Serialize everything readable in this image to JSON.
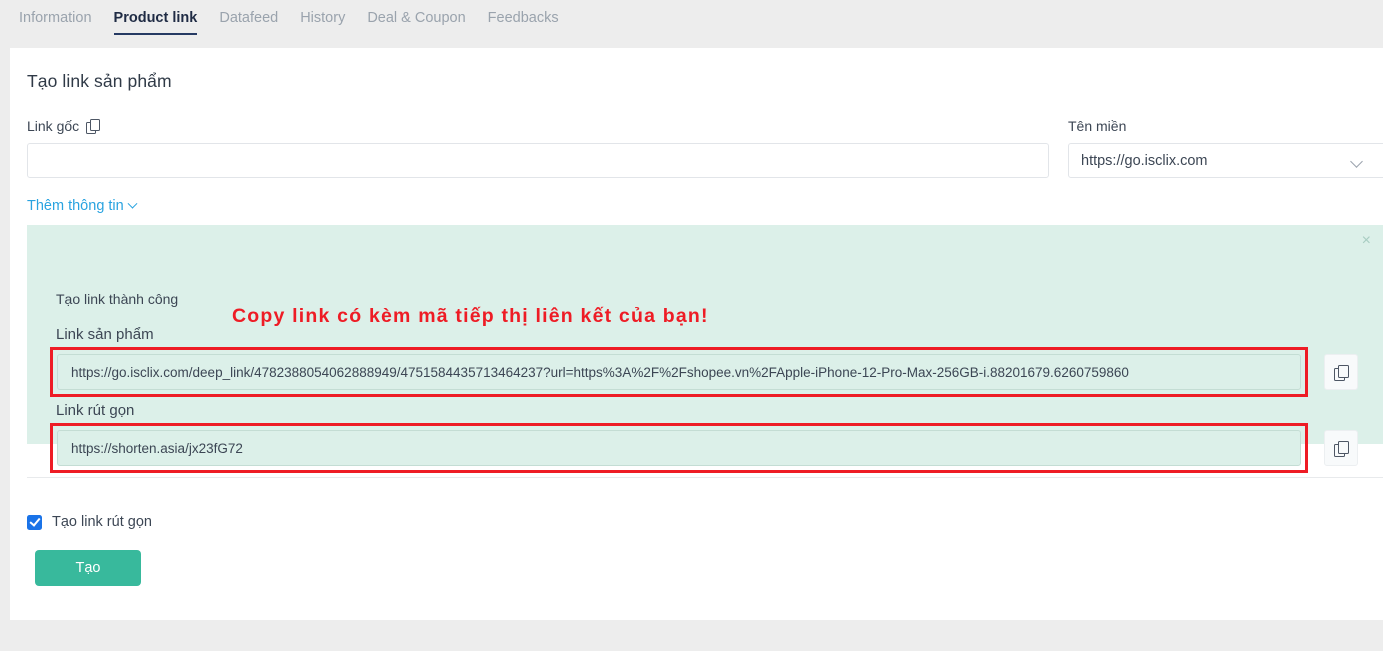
{
  "tabs": [
    {
      "label": "Information",
      "active": false
    },
    {
      "label": "Product link",
      "active": true
    },
    {
      "label": "Datafeed",
      "active": false
    },
    {
      "label": "History",
      "active": false
    },
    {
      "label": "Deal & Coupon",
      "active": false
    },
    {
      "label": "Feedbacks",
      "active": false
    }
  ],
  "page": {
    "title": "Tạo link sản phẩm"
  },
  "form": {
    "original_link_label": "Link gốc",
    "original_link_value": "",
    "original_link_placeholder": "",
    "domain_label": "Tên miền",
    "domain_value": "https://go.isclix.com",
    "more_info_label": "Thêm thông tin"
  },
  "banner": {
    "title": "Tạo link thành công",
    "annotation": "Copy link có kèm mã tiếp thị liên kết của bạn!",
    "close_label": "×",
    "product_link_label": "Link sản phẩm",
    "product_link_value": "https://go.isclix.com/deep_link/4782388054062888949/4751584435713464237?url=https%3A%2F%2Fshopee.vn%2FApple-iPhone-12-Pro-Max-256GB-i.88201679.6260759860",
    "short_link_label": "Link rút gọn",
    "short_link_value": "https://shorten.asia/jx23fG72"
  },
  "footer": {
    "checkbox_label": "Tạo link rút gọn",
    "checkbox_checked": true,
    "create_button_label": "Tạo"
  },
  "colors": {
    "accent_green": "#38b99c",
    "banner_bg": "#dcf0e9",
    "annotation_red": "#ee1c25",
    "link_blue": "#29a3e0",
    "checkbox_blue": "#1a73e8",
    "tab_active": "#1f2b44",
    "page_bg": "#ededed"
  }
}
